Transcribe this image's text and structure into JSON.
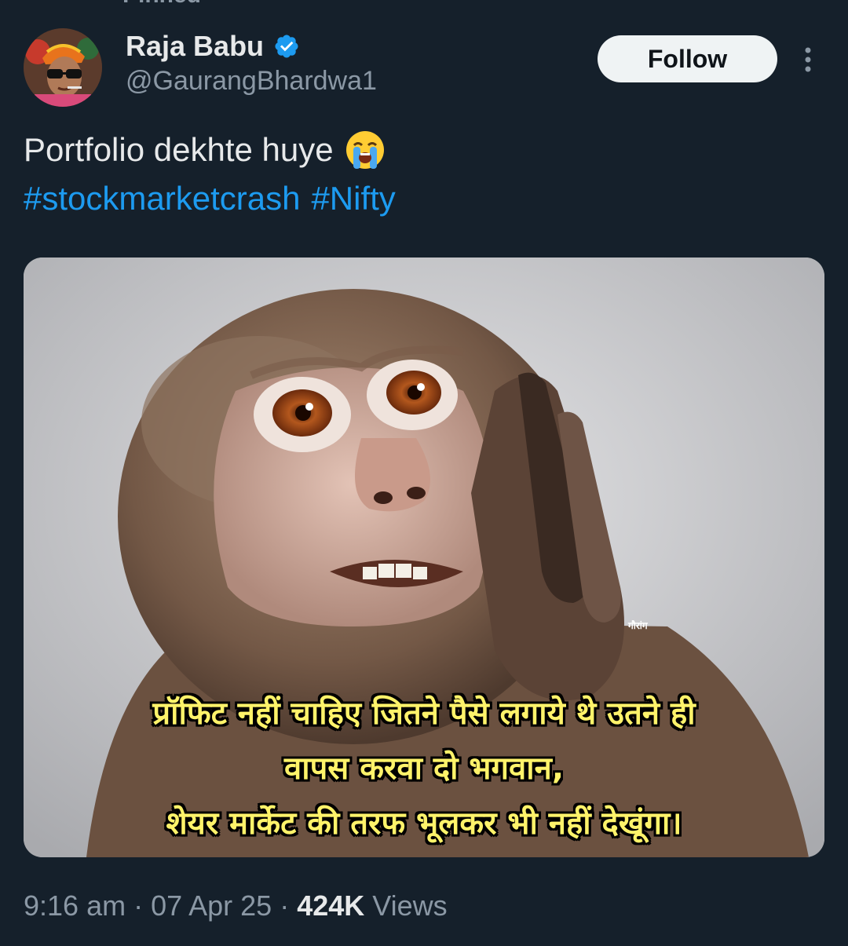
{
  "pinned": {
    "label": "Pinned"
  },
  "author": {
    "display_name": "Raja Babu",
    "handle": "@GaurangBhardwa1",
    "verified": true
  },
  "header": {
    "follow_label": "Follow"
  },
  "tweet": {
    "text": "Portfolio dekhte huye",
    "emoji": "loudly-crying-face-icon",
    "hashtags": [
      "#stockmarketcrash",
      "#Nifty"
    ]
  },
  "media": {
    "caption_lines": [
      "प्रॉफिट नहीं चाहिए जितने पैसे लगाये थे उतने ही",
      "वापस करवा दो भगवान,",
      "शेयर मार्केट की तरफ भूलकर भी नहीं देखूंगा।"
    ],
    "watermark": "गौरांग"
  },
  "meta": {
    "time": "9:16 am",
    "separator": "·",
    "date": "07 Apr 25",
    "views_count": "424K",
    "views_label": "Views"
  },
  "colors": {
    "background": "#15202b",
    "text_primary": "#e7e9ea",
    "text_secondary": "#8b98a5",
    "accent": "#1d9bf0",
    "caption": "#fff36a"
  }
}
